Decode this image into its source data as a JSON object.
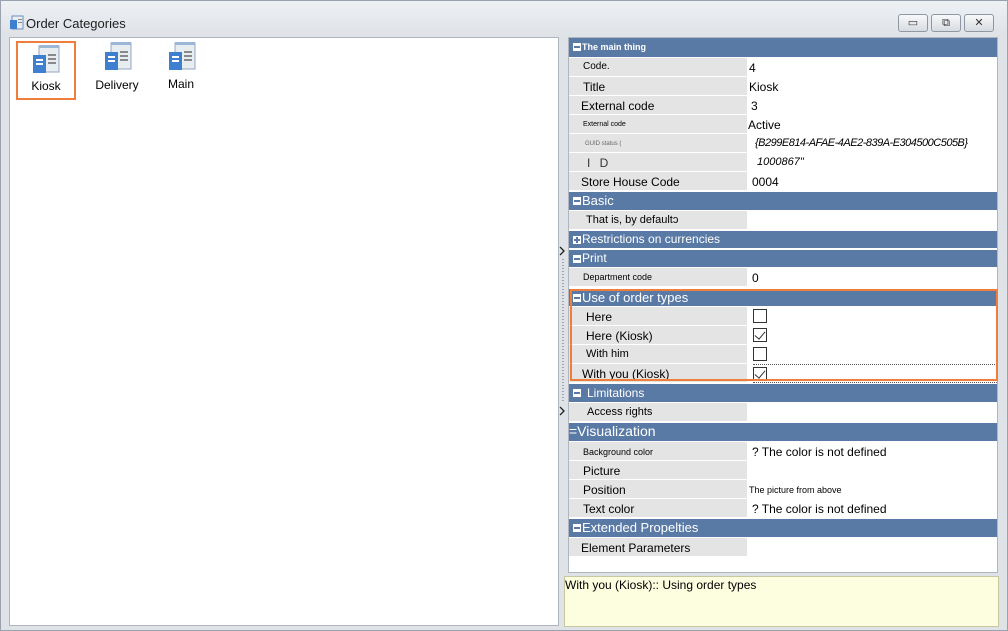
{
  "window": {
    "title": "Order Categories",
    "buttons": {
      "minimize": "▭",
      "restore": "⧉",
      "close": "✕"
    }
  },
  "categories": [
    {
      "label": "Kiosk",
      "selected": true
    },
    {
      "label": "Delivery",
      "selected": false
    },
    {
      "label": "Main",
      "selected": false
    }
  ],
  "properties": {
    "main_thing": {
      "header": "The main thing",
      "rows": [
        {
          "name": "Code.",
          "value": "4"
        },
        {
          "name": "Title",
          "value": "Kiosk"
        },
        {
          "name": "External code",
          "value": "3"
        },
        {
          "name": "External code",
          "value": "Active"
        },
        {
          "name": "GUID status (",
          "value": "{B299E814-AFAE-4AE2-839A-E304500C505B}"
        },
        {
          "name": "I D",
          "value": "1000867\""
        },
        {
          "name": "Store House Code",
          "value": "0004"
        }
      ]
    },
    "basic": {
      "header": "Basic",
      "rows": [
        {
          "name": "That is, by defaultɔ",
          "value": ""
        }
      ]
    },
    "restrictions": {
      "header": "Restrictions on currencies"
    },
    "print": {
      "header": "Print",
      "rows": [
        {
          "name": "Department code",
          "value": "0"
        }
      ]
    },
    "order_types": {
      "header": "Use of order types",
      "rows": [
        {
          "name": "Here",
          "checked": false
        },
        {
          "name": "Here (Kiosk)",
          "checked": true
        },
        {
          "name": "With him",
          "checked": false
        },
        {
          "name": "With you (Kiosk)",
          "checked": true
        }
      ]
    },
    "limitations": {
      "header": "Limitations",
      "rows": [
        {
          "name": "Access rights",
          "value": ""
        }
      ]
    },
    "visualization": {
      "header": "=Visualization",
      "rows": [
        {
          "name": "Background color",
          "value": "? The color is not defined"
        },
        {
          "name": "Picture",
          "value": ""
        },
        {
          "name": "Position",
          "value": "The picture from above"
        },
        {
          "name": "Text color",
          "value": "? The color is not defined"
        }
      ]
    },
    "extended": {
      "header": "Extended Propelties",
      "rows": [
        {
          "name": "Element Parameters",
          "value": ""
        }
      ]
    }
  },
  "description": "With you (Kiosk):: Using order types",
  "colors": {
    "section_header": "#5a7aa6",
    "highlight": "#ef7d3c",
    "description_bg": "#fdfde0"
  }
}
